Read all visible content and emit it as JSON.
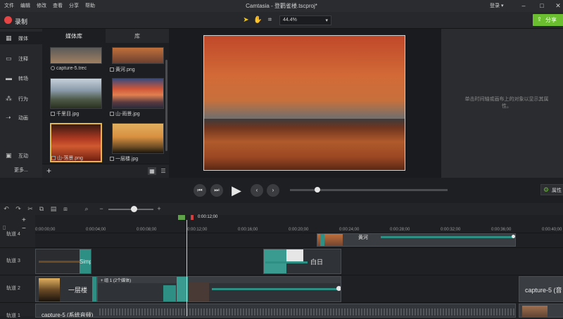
{
  "menu": [
    "文件",
    "编辑",
    "修改",
    "查看",
    "分享",
    "帮助"
  ],
  "app_title": "Camtasia - 登鹳雀楼.tscproj*",
  "login_label": "登录 ▾",
  "toolbar": {
    "record_label": "录制",
    "zoom_value": "44.4%",
    "share_label": "分享"
  },
  "sidebar": {
    "items": [
      {
        "label": "媒体",
        "icon": "media-icon"
      },
      {
        "label": "注释",
        "icon": "annotation-icon"
      },
      {
        "label": "转场",
        "icon": "transition-icon"
      },
      {
        "label": "行为",
        "icon": "behavior-icon"
      },
      {
        "label": "动画",
        "icon": "animation-icon"
      },
      {
        "label": "互动",
        "icon": "interactive-icon"
      }
    ],
    "more_label": "更多..."
  },
  "media_panel": {
    "tabs": [
      "媒体库",
      "库"
    ],
    "thumbs": [
      {
        "caption": "capture-5.trec",
        "colors": [
          "#6a6a6a",
          "#a08060"
        ]
      },
      {
        "caption": "黄河.png",
        "colors": [
          "#b8693a",
          "#6a4030"
        ]
      },
      {
        "caption": "千里目.jpg",
        "colors": [
          "#8a9aa8",
          "#3e4a3a"
        ]
      },
      {
        "caption": "山-雨景.jpg",
        "colors": [
          "#d0573a",
          "#394a6a"
        ]
      },
      {
        "caption": "山-落景.png",
        "colors": [
          "#c04030",
          "#5a1a10"
        ]
      },
      {
        "caption": "一层楼.jpg",
        "colors": [
          "#d8a050",
          "#2a2015"
        ]
      }
    ]
  },
  "properties_msg": "单击时间轴或画布上的对象以显示其属性。",
  "properties_btn": "属性",
  "ruler": {
    "playhead_time": "0:00:12;00",
    "ticks": [
      "0:00:00;00",
      "0:00:04;00",
      "0:00:08;00",
      "0:00:12;00",
      "0:00:16;00",
      "0:00:20;00",
      "0:00:24;00",
      "0:00:28;00",
      "0:00:32;00",
      "0:00:36;00",
      "0:00:40;00"
    ]
  },
  "tracks": {
    "track4": "轨道 4",
    "track3": "轨道 3",
    "track2": "轨道 2",
    "track1": "轨道 1"
  },
  "clips": {
    "t4_label": "黄河",
    "t3_simp": "Simp",
    "t3_baihi": "白日",
    "t2_label": "一层楼",
    "t2_group": "+ 组 1 (2个媒体)",
    "t2_capture": "capture-5 (音",
    "t1_label": "capture-5 (系统音频)"
  }
}
